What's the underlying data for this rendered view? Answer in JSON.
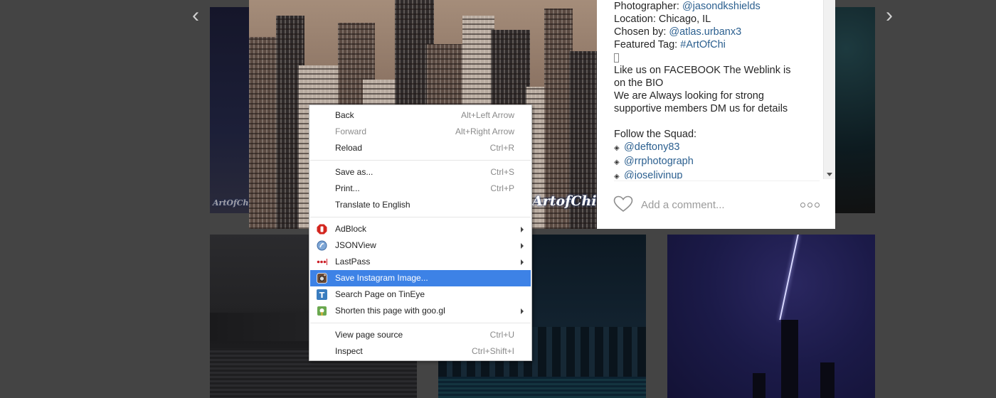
{
  "nav": {
    "prev": "‹",
    "next": "›"
  },
  "photo": {
    "watermark": "ArtofChi",
    "watermark_left": "ArtOfChi"
  },
  "caption": {
    "photographer_label": "Photographer: ",
    "photographer": "@jasondkshields",
    "location": "Location: Chicago, IL",
    "chosen_label": "Chosen by: ",
    "chosen": "@atlas.urbanx3",
    "tag_label": "Featured Tag: ",
    "tag": "#ArtOfChi",
    "facebook_line1": "Like us on FACEBOOK The Weblink is",
    "facebook_line2": "on the BIO",
    "members_line1": "We are Always looking for strong",
    "members_line2": "supportive members DM us for details",
    "follow": "Follow the Squad:",
    "members": [
      "@deftony83",
      "@rrphotograph",
      "@joselivinup"
    ],
    "bullet": "◈"
  },
  "comment": {
    "placeholder": "Add a comment..."
  },
  "menu": {
    "back": {
      "label": "Back",
      "shortcut": "Alt+Left Arrow"
    },
    "forward": {
      "label": "Forward",
      "shortcut": "Alt+Right Arrow"
    },
    "reload": {
      "label": "Reload",
      "shortcut": "Ctrl+R"
    },
    "save_as": {
      "label": "Save as...",
      "shortcut": "Ctrl+S"
    },
    "print": {
      "label": "Print...",
      "shortcut": "Ctrl+P"
    },
    "translate": {
      "label": "Translate to English"
    },
    "adblock": {
      "label": "AdBlock"
    },
    "jsonview": {
      "label": "JSONView"
    },
    "lastpass": {
      "label": "LastPass"
    },
    "save_instagram": {
      "label": "Save Instagram Image..."
    },
    "tineye": {
      "label": "Search Page on TinEye"
    },
    "googl": {
      "label": "Shorten this page with goo.gl"
    },
    "view_source": {
      "label": "View page source",
      "shortcut": "Ctrl+U"
    },
    "inspect": {
      "label": "Inspect",
      "shortcut": "Ctrl+Shift+I"
    }
  },
  "colors": {
    "highlight": "#3d82e6",
    "link": "#2b5f8f",
    "backdrop": "#444444"
  }
}
